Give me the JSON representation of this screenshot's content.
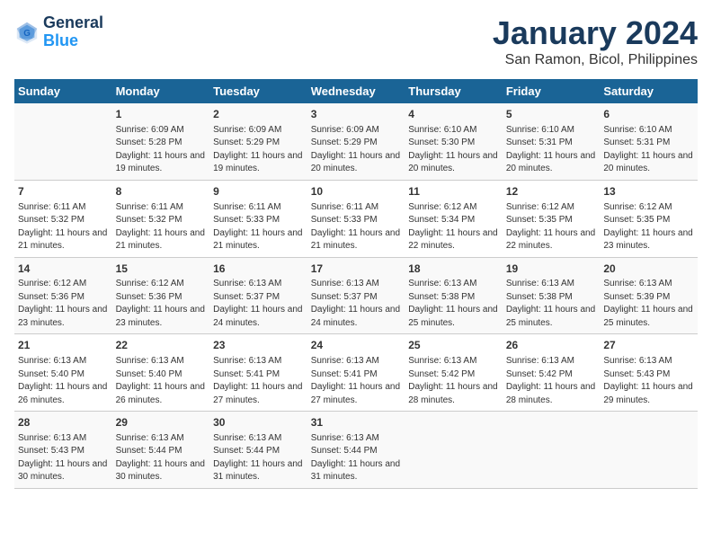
{
  "logo": {
    "line1": "General",
    "line2": "Blue"
  },
  "title": "January 2024",
  "subtitle": "San Ramon, Bicol, Philippines",
  "days_header": [
    "Sunday",
    "Monday",
    "Tuesday",
    "Wednesday",
    "Thursday",
    "Friday",
    "Saturday"
  ],
  "weeks": [
    [
      {
        "num": "",
        "sunrise": "",
        "sunset": "",
        "daylight": ""
      },
      {
        "num": "1",
        "sunrise": "Sunrise: 6:09 AM",
        "sunset": "Sunset: 5:28 PM",
        "daylight": "Daylight: 11 hours and 19 minutes."
      },
      {
        "num": "2",
        "sunrise": "Sunrise: 6:09 AM",
        "sunset": "Sunset: 5:29 PM",
        "daylight": "Daylight: 11 hours and 19 minutes."
      },
      {
        "num": "3",
        "sunrise": "Sunrise: 6:09 AM",
        "sunset": "Sunset: 5:29 PM",
        "daylight": "Daylight: 11 hours and 20 minutes."
      },
      {
        "num": "4",
        "sunrise": "Sunrise: 6:10 AM",
        "sunset": "Sunset: 5:30 PM",
        "daylight": "Daylight: 11 hours and 20 minutes."
      },
      {
        "num": "5",
        "sunrise": "Sunrise: 6:10 AM",
        "sunset": "Sunset: 5:31 PM",
        "daylight": "Daylight: 11 hours and 20 minutes."
      },
      {
        "num": "6",
        "sunrise": "Sunrise: 6:10 AM",
        "sunset": "Sunset: 5:31 PM",
        "daylight": "Daylight: 11 hours and 20 minutes."
      }
    ],
    [
      {
        "num": "7",
        "sunrise": "Sunrise: 6:11 AM",
        "sunset": "Sunset: 5:32 PM",
        "daylight": "Daylight: 11 hours and 21 minutes."
      },
      {
        "num": "8",
        "sunrise": "Sunrise: 6:11 AM",
        "sunset": "Sunset: 5:32 PM",
        "daylight": "Daylight: 11 hours and 21 minutes."
      },
      {
        "num": "9",
        "sunrise": "Sunrise: 6:11 AM",
        "sunset": "Sunset: 5:33 PM",
        "daylight": "Daylight: 11 hours and 21 minutes."
      },
      {
        "num": "10",
        "sunrise": "Sunrise: 6:11 AM",
        "sunset": "Sunset: 5:33 PM",
        "daylight": "Daylight: 11 hours and 21 minutes."
      },
      {
        "num": "11",
        "sunrise": "Sunrise: 6:12 AM",
        "sunset": "Sunset: 5:34 PM",
        "daylight": "Daylight: 11 hours and 22 minutes."
      },
      {
        "num": "12",
        "sunrise": "Sunrise: 6:12 AM",
        "sunset": "Sunset: 5:35 PM",
        "daylight": "Daylight: 11 hours and 22 minutes."
      },
      {
        "num": "13",
        "sunrise": "Sunrise: 6:12 AM",
        "sunset": "Sunset: 5:35 PM",
        "daylight": "Daylight: 11 hours and 23 minutes."
      }
    ],
    [
      {
        "num": "14",
        "sunrise": "Sunrise: 6:12 AM",
        "sunset": "Sunset: 5:36 PM",
        "daylight": "Daylight: 11 hours and 23 minutes."
      },
      {
        "num": "15",
        "sunrise": "Sunrise: 6:12 AM",
        "sunset": "Sunset: 5:36 PM",
        "daylight": "Daylight: 11 hours and 23 minutes."
      },
      {
        "num": "16",
        "sunrise": "Sunrise: 6:13 AM",
        "sunset": "Sunset: 5:37 PM",
        "daylight": "Daylight: 11 hours and 24 minutes."
      },
      {
        "num": "17",
        "sunrise": "Sunrise: 6:13 AM",
        "sunset": "Sunset: 5:37 PM",
        "daylight": "Daylight: 11 hours and 24 minutes."
      },
      {
        "num": "18",
        "sunrise": "Sunrise: 6:13 AM",
        "sunset": "Sunset: 5:38 PM",
        "daylight": "Daylight: 11 hours and 25 minutes."
      },
      {
        "num": "19",
        "sunrise": "Sunrise: 6:13 AM",
        "sunset": "Sunset: 5:38 PM",
        "daylight": "Daylight: 11 hours and 25 minutes."
      },
      {
        "num": "20",
        "sunrise": "Sunrise: 6:13 AM",
        "sunset": "Sunset: 5:39 PM",
        "daylight": "Daylight: 11 hours and 25 minutes."
      }
    ],
    [
      {
        "num": "21",
        "sunrise": "Sunrise: 6:13 AM",
        "sunset": "Sunset: 5:40 PM",
        "daylight": "Daylight: 11 hours and 26 minutes."
      },
      {
        "num": "22",
        "sunrise": "Sunrise: 6:13 AM",
        "sunset": "Sunset: 5:40 PM",
        "daylight": "Daylight: 11 hours and 26 minutes."
      },
      {
        "num": "23",
        "sunrise": "Sunrise: 6:13 AM",
        "sunset": "Sunset: 5:41 PM",
        "daylight": "Daylight: 11 hours and 27 minutes."
      },
      {
        "num": "24",
        "sunrise": "Sunrise: 6:13 AM",
        "sunset": "Sunset: 5:41 PM",
        "daylight": "Daylight: 11 hours and 27 minutes."
      },
      {
        "num": "25",
        "sunrise": "Sunrise: 6:13 AM",
        "sunset": "Sunset: 5:42 PM",
        "daylight": "Daylight: 11 hours and 28 minutes."
      },
      {
        "num": "26",
        "sunrise": "Sunrise: 6:13 AM",
        "sunset": "Sunset: 5:42 PM",
        "daylight": "Daylight: 11 hours and 28 minutes."
      },
      {
        "num": "27",
        "sunrise": "Sunrise: 6:13 AM",
        "sunset": "Sunset: 5:43 PM",
        "daylight": "Daylight: 11 hours and 29 minutes."
      }
    ],
    [
      {
        "num": "28",
        "sunrise": "Sunrise: 6:13 AM",
        "sunset": "Sunset: 5:43 PM",
        "daylight": "Daylight: 11 hours and 30 minutes."
      },
      {
        "num": "29",
        "sunrise": "Sunrise: 6:13 AM",
        "sunset": "Sunset: 5:44 PM",
        "daylight": "Daylight: 11 hours and 30 minutes."
      },
      {
        "num": "30",
        "sunrise": "Sunrise: 6:13 AM",
        "sunset": "Sunset: 5:44 PM",
        "daylight": "Daylight: 11 hours and 31 minutes."
      },
      {
        "num": "31",
        "sunrise": "Sunrise: 6:13 AM",
        "sunset": "Sunset: 5:44 PM",
        "daylight": "Daylight: 11 hours and 31 minutes."
      },
      {
        "num": "",
        "sunrise": "",
        "sunset": "",
        "daylight": ""
      },
      {
        "num": "",
        "sunrise": "",
        "sunset": "",
        "daylight": ""
      },
      {
        "num": "",
        "sunrise": "",
        "sunset": "",
        "daylight": ""
      }
    ]
  ]
}
